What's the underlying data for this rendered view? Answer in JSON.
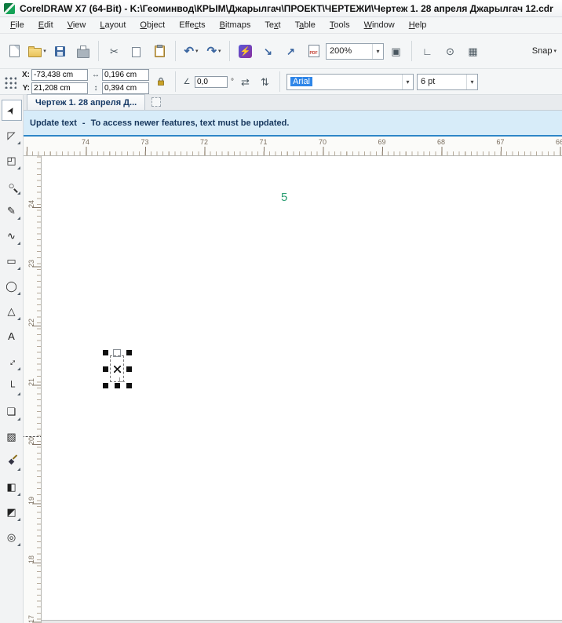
{
  "window": {
    "title": "CorelDRAW X7 (64-Bit) - K:\\Геоминвод\\КРЫМ\\Джарылгач\\ПРОЕКТ\\ЧЕРТЕЖИ\\Чертеж 1. 28 апреля Джарылгач 12.cdr"
  },
  "menu": {
    "items": [
      {
        "label": "File",
        "accel": 0
      },
      {
        "label": "Edit",
        "accel": 0
      },
      {
        "label": "View",
        "accel": 0
      },
      {
        "label": "Layout",
        "accel": 0
      },
      {
        "label": "Object",
        "accel": 0
      },
      {
        "label": "Effects",
        "accel": 4
      },
      {
        "label": "Bitmaps",
        "accel": 0
      },
      {
        "label": "Text",
        "accel": 2
      },
      {
        "label": "Table",
        "accel": 1
      },
      {
        "label": "Tools",
        "accel": 0
      },
      {
        "label": "Window",
        "accel": 0
      },
      {
        "label": "Help",
        "accel": 0
      }
    ]
  },
  "toolbar": {
    "zoom_value": "200%",
    "snap_label": "Snap",
    "pdf_label": "PDF"
  },
  "icons": {
    "caret": "▾",
    "cut": "✂",
    "undo": "↶",
    "redo": "↷",
    "lightning": "⚡",
    "import": "↘",
    "export": "↗",
    "fullscreen": "▣",
    "rulers_glyph": "∟",
    "preview": "⊙",
    "grid": "▦",
    "width": "↔",
    "height": "↕",
    "angle": "∠",
    "mirror_h": "⇄",
    "mirror_v": "⇅"
  },
  "property_bar": {
    "x_label": "X:",
    "x_value": "-73,438 cm",
    "y_label": "Y:",
    "y_value": "21,208 cm",
    "width_value": "0,196 cm",
    "height_value": "0,394 cm",
    "angle_value": "0,0",
    "angle_unit": "°",
    "font_family": "Arial",
    "font_size": "6 pt"
  },
  "document": {
    "tab_label": "Чертеж 1. 28 апреля Д..."
  },
  "update_bar": {
    "title": "Update text",
    "dash": "-",
    "message": "To access newer features, text must be updated."
  },
  "rulers": {
    "horizontal": [
      "74",
      "73",
      "72",
      "71",
      "70",
      "69",
      "68",
      "67",
      "66"
    ],
    "vertical": [
      "24",
      "23",
      "22",
      "21",
      "20",
      "19",
      "18",
      "17"
    ]
  },
  "canvas": {
    "label": "5",
    "label_color": "#2a9d72"
  },
  "toolbox": {
    "tools": [
      {
        "name": "pick-tool",
        "glyph": "➤",
        "selected": true,
        "flyout": false
      },
      {
        "name": "shape-tool",
        "glyph": "◸",
        "selected": false,
        "flyout": true
      },
      {
        "name": "crop-tool",
        "glyph": "◰",
        "selected": false,
        "flyout": true
      },
      {
        "name": "zoom-tool",
        "glyph": "○",
        "selected": false,
        "flyout": true
      },
      {
        "name": "freehand-tool",
        "glyph": "✎",
        "selected": false,
        "flyout": true
      },
      {
        "name": "artistic-media-tool",
        "glyph": "∿",
        "selected": false,
        "flyout": true
      },
      {
        "name": "rectangle-tool",
        "glyph": "▭",
        "selected": false,
        "flyout": true
      },
      {
        "name": "ellipse-tool",
        "glyph": "◯",
        "selected": false,
        "flyout": true
      },
      {
        "name": "polygon-tool",
        "glyph": "△",
        "selected": false,
        "flyout": true
      },
      {
        "name": "text-tool",
        "glyph": "A",
        "selected": false,
        "flyout": false
      },
      {
        "name": "parallel-dimension-tool",
        "glyph": "↔",
        "selected": false,
        "flyout": true
      },
      {
        "name": "connector-tool",
        "glyph": "└",
        "selected": false,
        "flyout": true
      },
      {
        "name": "drop-shadow-tool",
        "glyph": "❏",
        "selected": false,
        "flyout": true
      },
      {
        "name": "transparency-tool",
        "glyph": "▨",
        "selected": false,
        "flyout": false
      },
      {
        "name": "color-eyedropper-tool",
        "glyph": "◆",
        "selected": false,
        "flyout": true
      },
      {
        "name": "interactive-fill-tool",
        "glyph": "◧",
        "selected": false,
        "flyout": true
      },
      {
        "name": "smart-fill-tool",
        "glyph": "◩",
        "selected": false,
        "flyout": true
      },
      {
        "name": "outline-tool",
        "glyph": "◎",
        "selected": false,
        "flyout": true
      }
    ]
  }
}
